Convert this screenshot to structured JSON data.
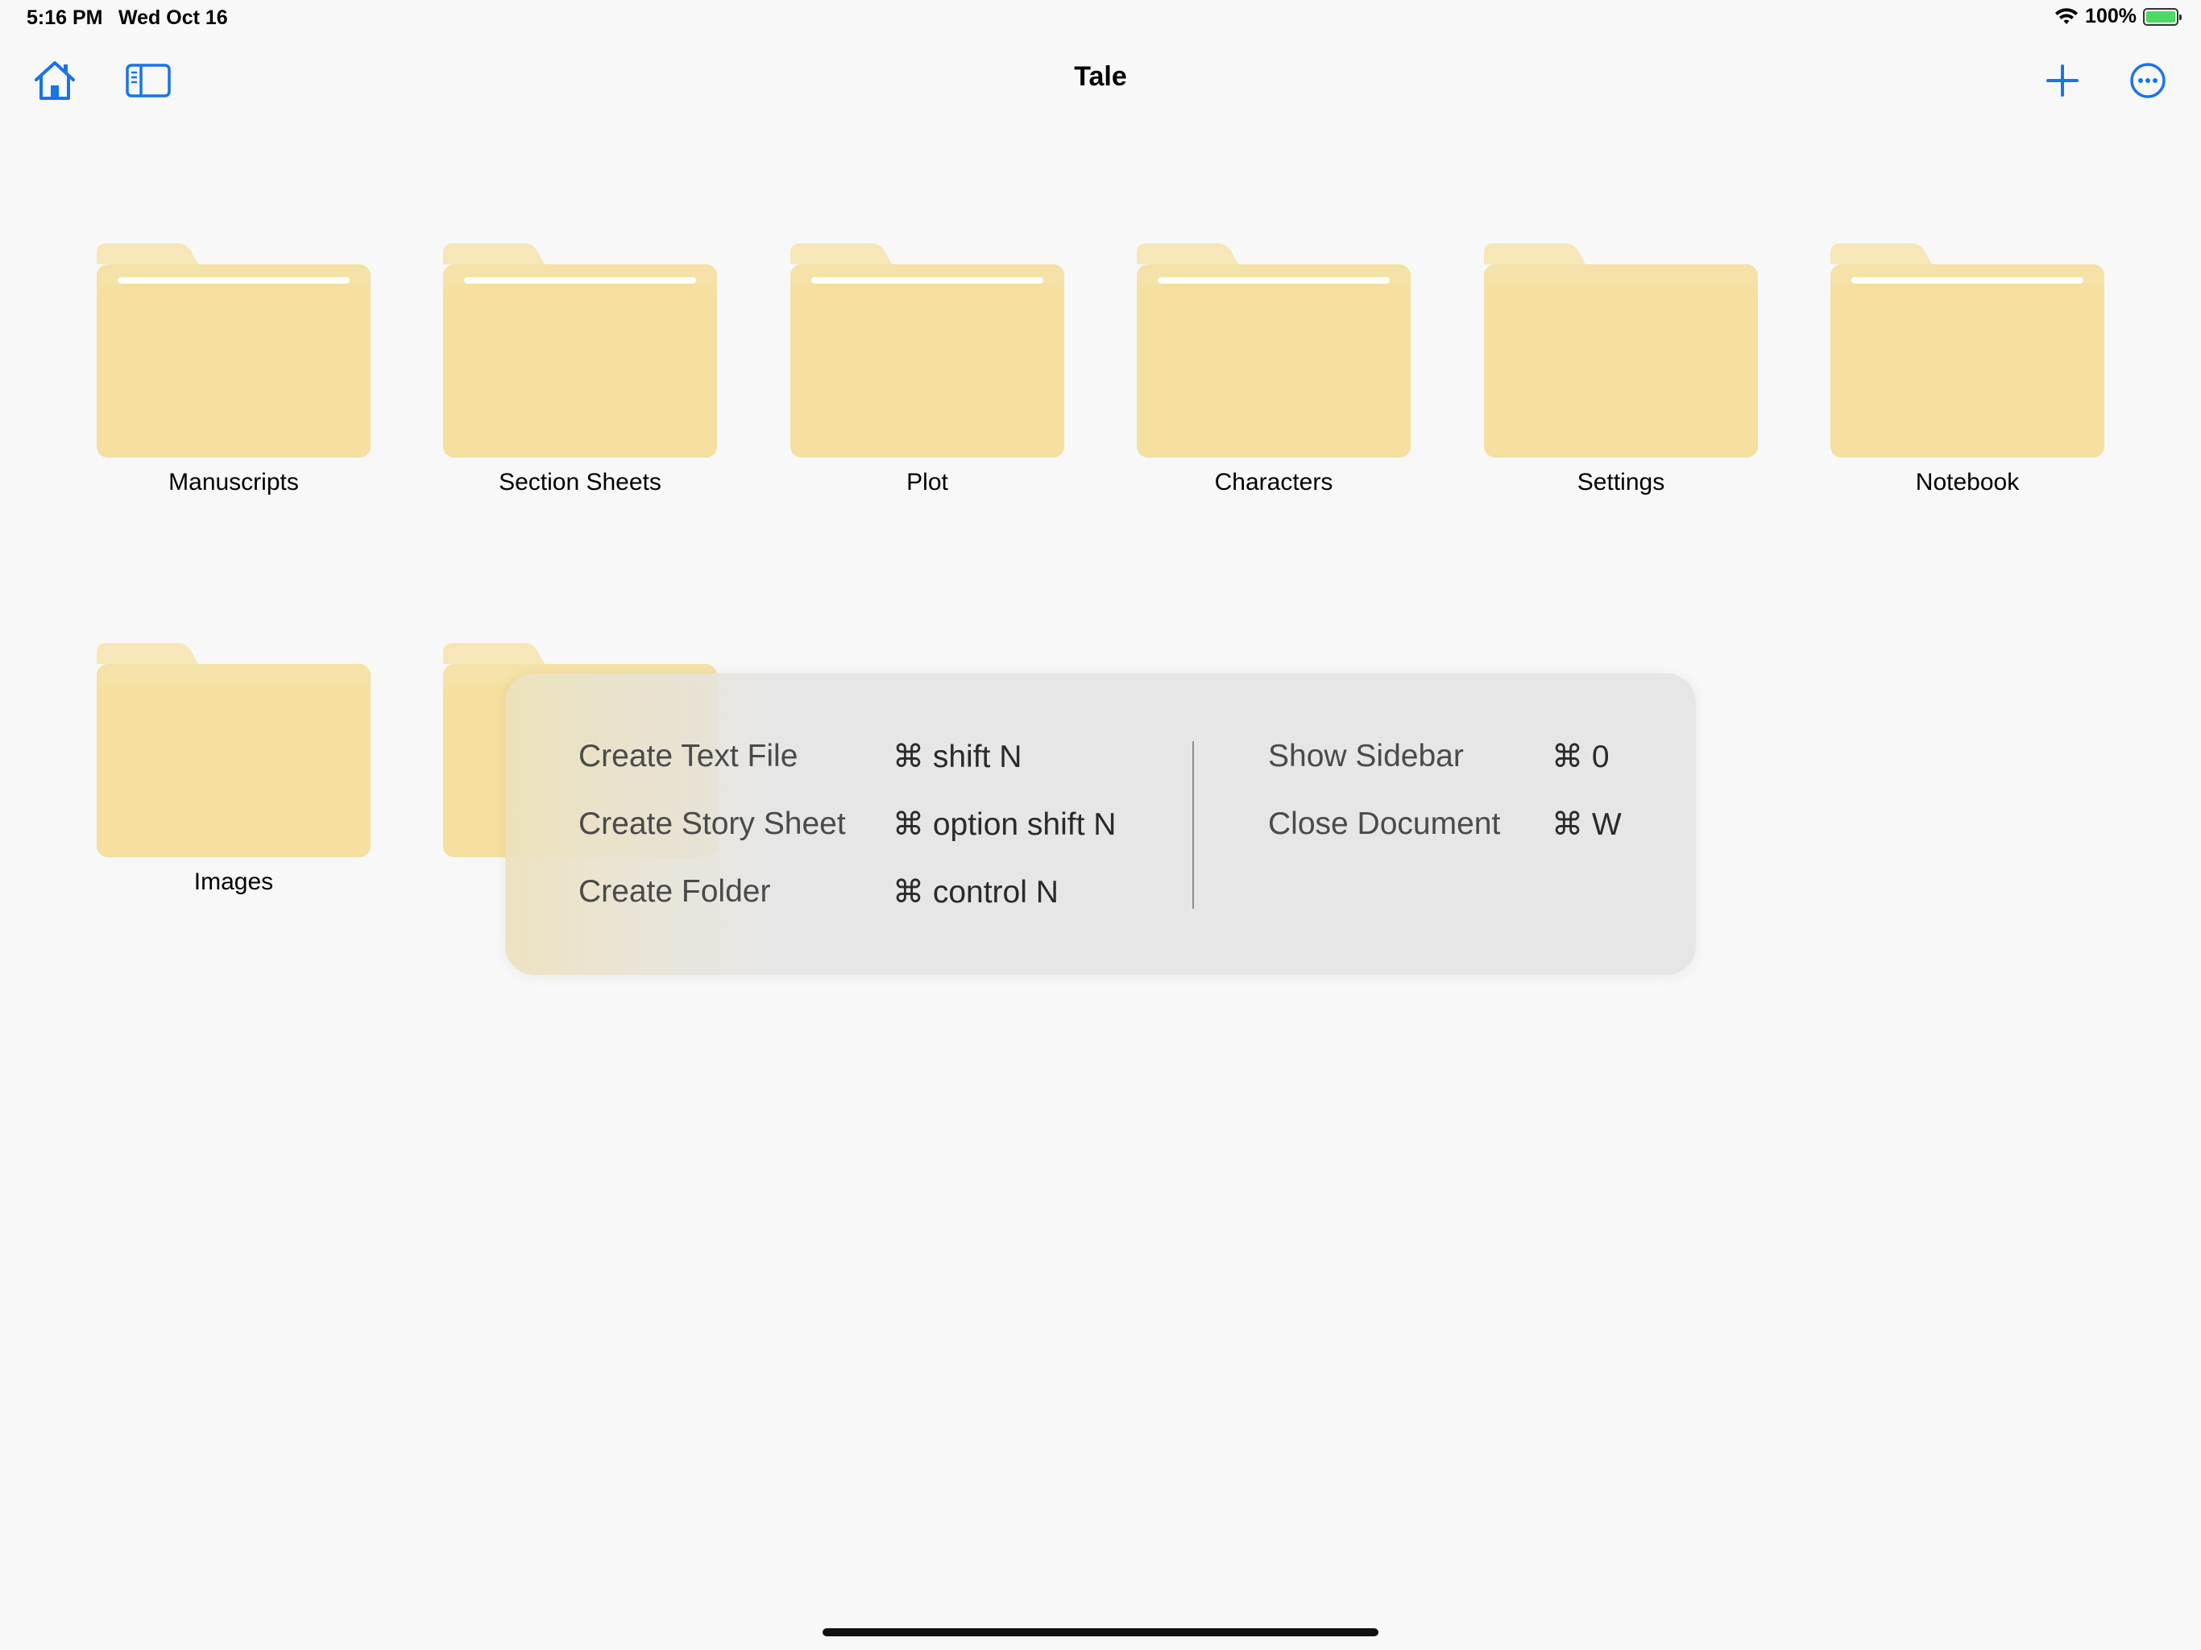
{
  "status_bar": {
    "time": "5:16 PM",
    "date": "Wed Oct 16",
    "battery": "100%"
  },
  "nav": {
    "title": "Tale"
  },
  "folders": [
    {
      "name": "Manuscripts"
    },
    {
      "name": "Section Sheets"
    },
    {
      "name": "Plot"
    },
    {
      "name": "Characters"
    },
    {
      "name": "Settings"
    },
    {
      "name": "Notebook"
    },
    {
      "name": "Images"
    }
  ],
  "shortcuts_left": [
    {
      "label": "Create Text File",
      "keys": "⌘ shift N"
    },
    {
      "label": "Create Story Sheet",
      "keys": "⌘ option shift N"
    },
    {
      "label": "Create Folder",
      "keys": "⌘ control N"
    }
  ],
  "shortcuts_right": [
    {
      "label": "Show Sidebar",
      "keys": "⌘ 0"
    },
    {
      "label": "Close Document",
      "keys": "⌘ W"
    }
  ],
  "colors": {
    "accent": "#1a73e8",
    "folder_body": "#f5e0a4",
    "folder_tab": "#f7e6b4"
  }
}
